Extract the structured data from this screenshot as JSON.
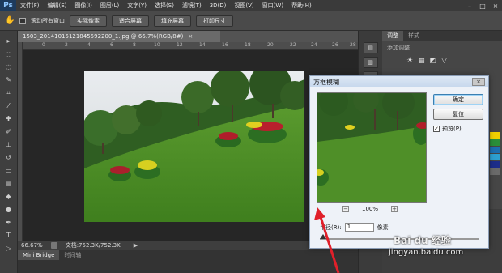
{
  "app": {
    "logo": "Ps"
  },
  "menu": [
    "文件(F)",
    "编辑(E)",
    "图像(I)",
    "图层(L)",
    "文字(Y)",
    "选择(S)",
    "滤镜(T)",
    "3D(D)",
    "视图(V)",
    "窗口(W)",
    "帮助(H)"
  ],
  "window_controls": {
    "minimize": "–",
    "maximize": "□",
    "close": "×"
  },
  "options": {
    "scroll_all_label": "滚动所有窗口",
    "actual_pixels": "实际像素",
    "fit_screen": "适合屏幕",
    "fill_screen": "填充屏幕",
    "print_size": "打印尺寸"
  },
  "document": {
    "tab_title": "1503_20141015121845592200_1.jpg @ 66.7%(RGB/8#)",
    "tab_close": "×",
    "ruler_ticks": [
      "0",
      "2",
      "4",
      "6",
      "8",
      "10",
      "12",
      "14",
      "16",
      "18",
      "20",
      "22",
      "24",
      "26",
      "28"
    ]
  },
  "status": {
    "zoom": "66.67%",
    "doc_size": "文档:752.3K/752.3K",
    "arrow": "▶"
  },
  "bottom_tabs": [
    "Mini Bridge",
    "时间轴"
  ],
  "panel": {
    "tabs": [
      "调整",
      "样式"
    ],
    "subtitle": "添加调整"
  },
  "dialog": {
    "title": "方框模糊",
    "close": "×",
    "ok": "确定",
    "reset": "复位",
    "preview_label": "预览(P)",
    "preview_checked": "✓",
    "zoom_minus": "−",
    "zoom_percent": "100%",
    "zoom_plus": "+",
    "radius_label": "半径(R):",
    "radius_value": "1",
    "radius_unit": "像素"
  },
  "watermark": {
    "brand": "Bai du 经验",
    "url": "jingyan.baidu.com"
  },
  "colors": {
    "accent_arrow": "#e0202a",
    "swatches": [
      "#f0d000",
      "#2a8f3a",
      "#1c6fb0",
      "#2d9fd0",
      "#1d2d8a",
      "#6a6a6a"
    ]
  },
  "icons": {
    "hand": "✋",
    "adjust": [
      "☀",
      "▦",
      "◩",
      "▽"
    ]
  }
}
